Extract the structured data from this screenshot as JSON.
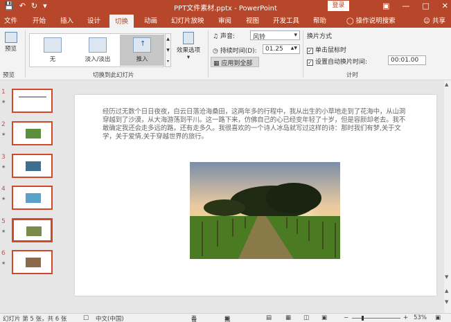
{
  "titlebar": {
    "title": "PPT文件素材.pptx - PowerPoint",
    "login_label": "登录",
    "qat_icons": [
      "save-icon",
      "undo-icon",
      "redo-icon",
      "customize-icon"
    ],
    "window_buttons": [
      "ribbon-display-icon",
      "minimize-icon",
      "maximize-icon",
      "close-icon"
    ]
  },
  "tabs": [
    "文件",
    "开始",
    "插入",
    "设计",
    "切换",
    "动画",
    "幻灯片放映",
    "审阅",
    "视图",
    "开发工具",
    "帮助"
  ],
  "active_tab": "切换",
  "tellme_label": "操作说明搜索",
  "share_label": "共享",
  "ribbon": {
    "preview_label": "预览",
    "preview_group_label": "预览",
    "gallery_items": [
      "无",
      "淡入/淡出",
      "推入"
    ],
    "effect_options_label": "效果选项",
    "transition_group_label": "切换到此幻灯片",
    "sound_label": "声音:",
    "sound_value": "风铃",
    "duration_label": "持续时间(D):",
    "duration_value": "01.25",
    "apply_all_label": "应用到全部",
    "advance_label": "换片方式",
    "on_click_label": "单击鼠标时",
    "on_click_checked": true,
    "after_label": "设置自动换片时间:",
    "after_checked": true,
    "after_value": "00:01.00",
    "timing_group_label": "计时"
  },
  "slides": {
    "numbers": [
      "1",
      "2",
      "3",
      "4",
      "5",
      "6"
    ],
    "selected": 5,
    "thumb_colors": [
      "#ffffff",
      "#5b8f3c",
      "#3f6f8f",
      "#5aa0c8",
      "#7a8a4a",
      "#8a6a4a"
    ]
  },
  "slide_content": {
    "paragraph": "经历过无数个日日夜夜，白云日落沧海桑田，这两年多的行程中，我从出生的小草地走到了花海中，从山洞穿越到了沙漠，从大海游荡到平川。这一路下来，仿佛自己的心已经变年轻了十岁，但是容颜却老去。我不敢确定我还会走多远的路，还有走多久。我很喜欢的一个诗人冰岛就写过这样的诗：那时我们有梦,关于文学，关于爱情,关于穿越世界的旅行。"
  },
  "statusbar": {
    "slide_info": "幻灯片 第 5 张，共 6 张",
    "language": "中文(中国)",
    "notes_label": "备注",
    "comments_label": "批注",
    "zoom": "53%"
  }
}
